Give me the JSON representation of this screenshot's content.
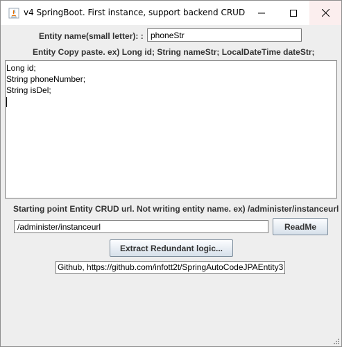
{
  "window": {
    "title": "v4 SpringBoot. First instance, support backend CRUD",
    "controls": {
      "minimize": "minimize-icon",
      "maximize": "maximize-icon",
      "close": "close-icon"
    }
  },
  "entity_name": {
    "label": "Entity name(small letter): :",
    "value": "phoneStr"
  },
  "entity_copy": {
    "label": "Entity Copy paste. ex) Long id; String nameStr; LocalDateTime dateStr;",
    "lines": [
      "Long id;",
      "String phoneNumber;",
      "String isDel;"
    ]
  },
  "crud_url": {
    "label": "Starting point Entity CRUD url. Not writing entity name. ex) /administer/instanceurl",
    "value": "/administer/instanceurl",
    "readme_button": "ReadMe"
  },
  "extract_button": "Extract Redundant logic...",
  "github_link": "Github, https://github.com/infott2t/SpringAutoCodeJPAEntity3"
}
